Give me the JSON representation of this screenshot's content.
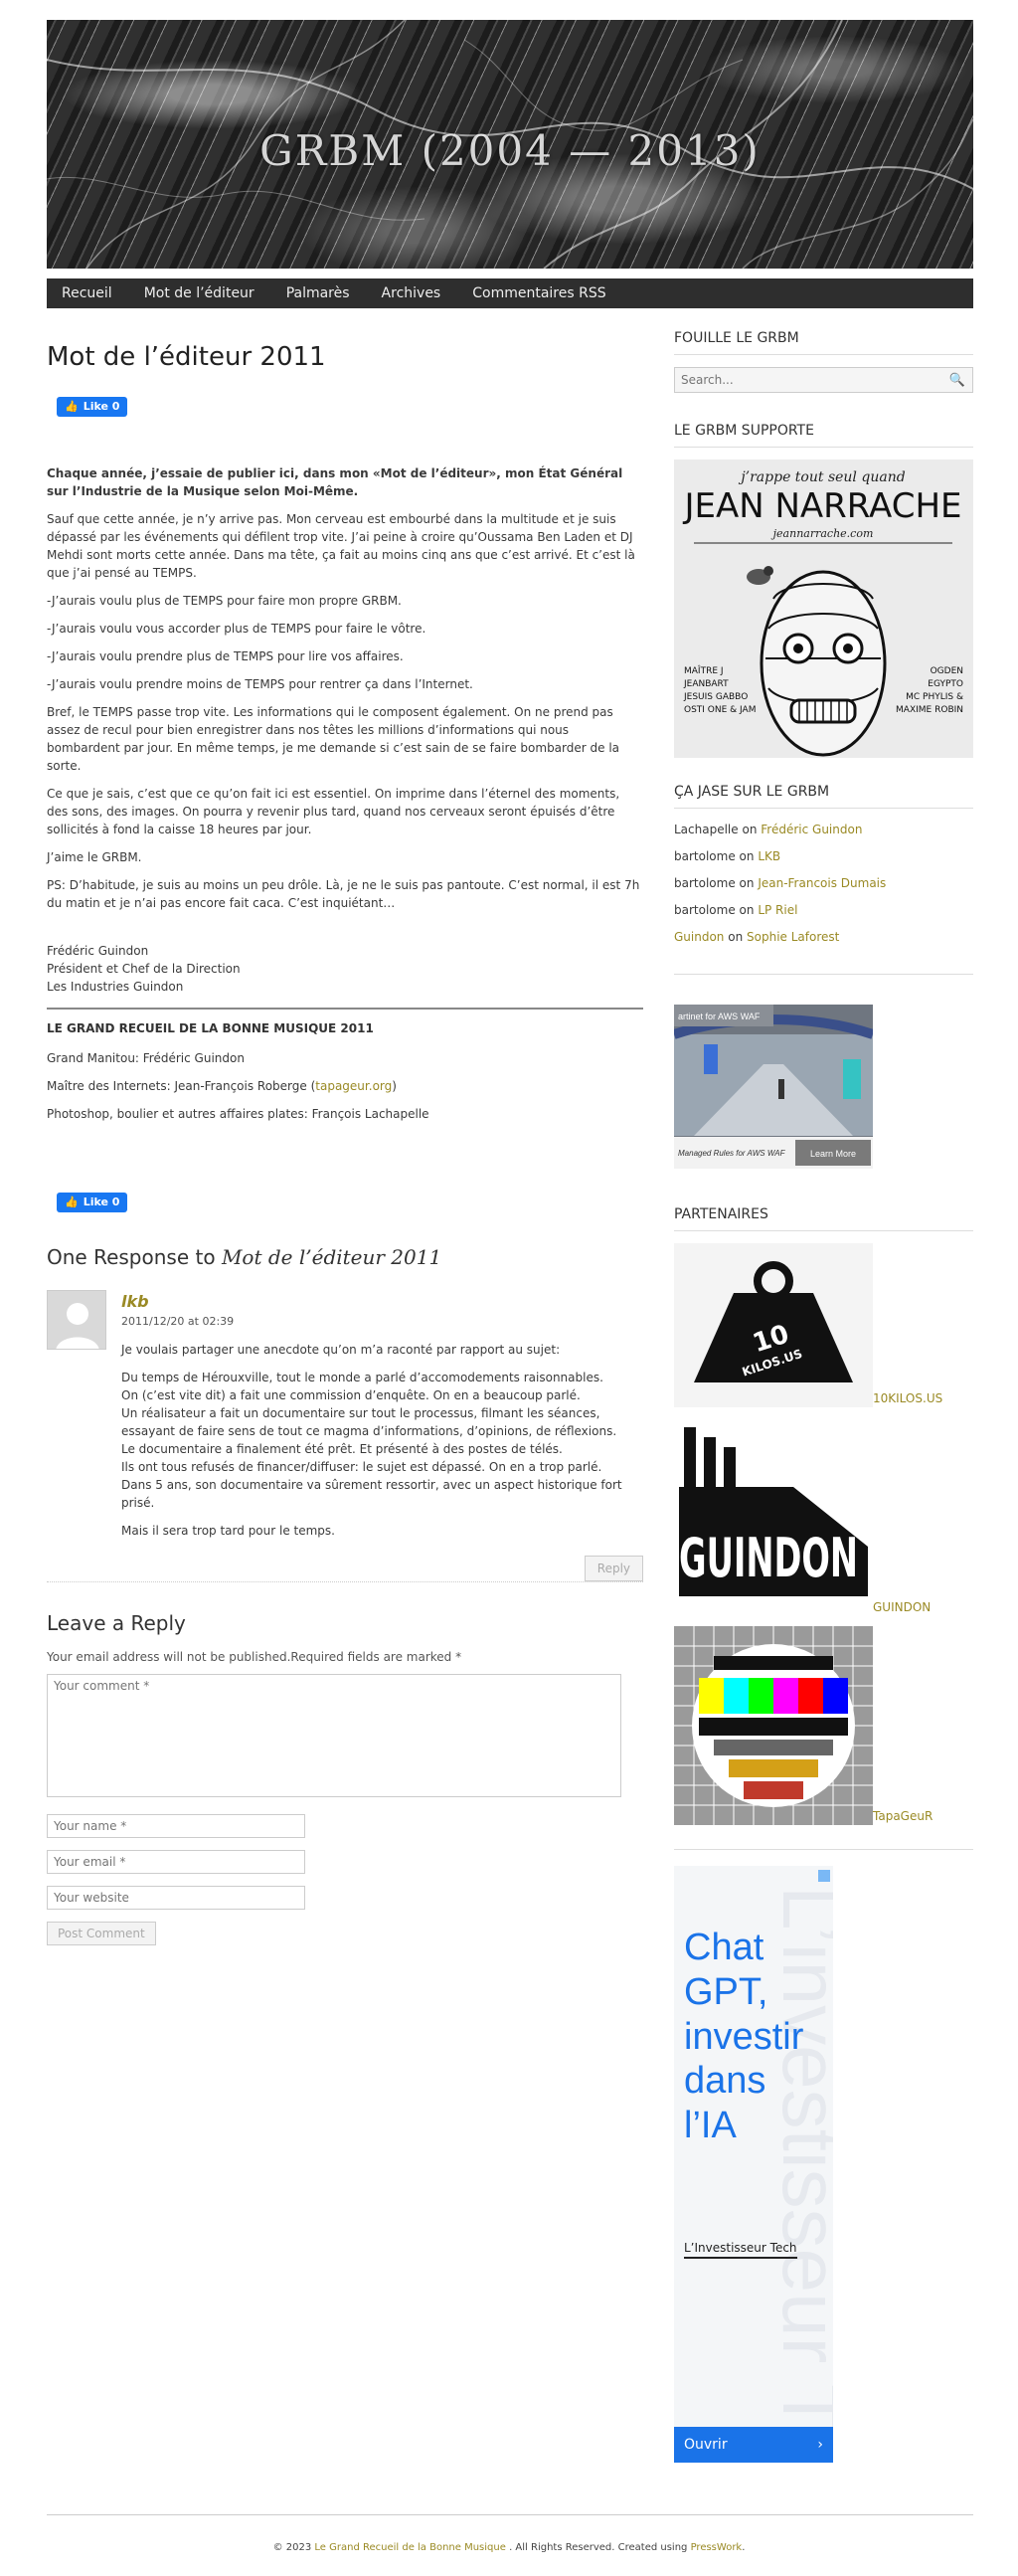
{
  "header": {
    "title": "GRBM (2004 — 2013)"
  },
  "nav": [
    "Recueil",
    "Mot de l’éditeur",
    "Palmarès",
    "Archives",
    "Commentaires RSS"
  ],
  "post": {
    "title": "Mot de l’éditeur 2011",
    "like_label": "Like 0",
    "lead": "Chaque année, j’essaie de publier ici, dans mon «Mot de l’éditeur», mon État Général sur l’Industrie de la Musique selon Moi-Même.",
    "paragraphs": [
      "Sauf que cette année, je n’y arrive pas. Mon cerveau est embourbé dans la multitude et je suis dépassé par les événements qui défilent trop vite.  J’ai peine à croire qu’Oussama Ben Laden et DJ Mehdi sont morts cette année. Dans ma tête, ça fait au moins cinq ans que c’est arrivé.  Et c’est là que j’ai pensé au TEMPS.",
      "-J’aurais voulu plus de TEMPS pour faire mon propre GRBM.",
      "-J’aurais voulu vous accorder plus de TEMPS pour faire le vôtre.",
      "-J’aurais voulu prendre plus de TEMPS pour lire vos affaires.",
      "-J’aurais voulu prendre moins de TEMPS pour rentrer ça dans l’Internet.",
      "Bref, le TEMPS passe trop vite. Les informations qui le composent également. On ne prend pas assez de recul pour bien enregistrer dans nos têtes les millions d’informations qui nous bombardent par jour. En même temps, je me demande si c’est sain de se faire bombarder de la sorte.",
      "Ce que je sais, c’est que ce qu’on fait ici est essentiel.  On imprime dans l’éternel des moments, des sons, des images. On pourra y revenir plus tard, quand nos cerveaux seront épuisés d’être sollicités à fond la caisse 18 heures par jour.",
      "J’aime le GRBM.",
      "PS: D’habitude, je suis au moins un peu drôle. Là, je ne le suis pas pantoute. C’est normal, il est 7h du matin et je n’ai pas encore fait caca. C’est inquiétant…"
    ],
    "signature": [
      "Frédéric Guindon",
      "Président et Chef de la Direction",
      "Les Industries Guindon"
    ],
    "credits_heading": "LE GRAND RECUEIL DE LA BONNE MUSIQUE 2011",
    "credit_manitou": "Grand Manitou: Frédéric Guindon",
    "credit_internet_pre": "Maître des Internets: Jean-François Roberge (",
    "credit_internet_link": "tapageur.org",
    "credit_internet_post": ")",
    "credit_photoshop": "Photoshop, boulier et autres affaires plates: François Lachapelle"
  },
  "comments": {
    "title_pre": "One Response to ",
    "title_em": "Mot de l’éditeur 2011",
    "items": [
      {
        "author": "lkb",
        "date": "2011/12/20 at 02:39",
        "intro": "Je voulais partager une anecdote qu’on m’a raconté par rapport au sujet:",
        "lines": [
          "Du temps de Hérouxville, tout le monde a parlé d’accomodements raisonnables.",
          "On (c’est vite dit) a fait une commission d’enquête. On en a beaucoup parlé.",
          "Un réalisateur a fait un documentaire sur tout le processus, filmant les séances, essayant de faire sens de tout ce magma d’informations, d’opinions, de réflexions.",
          "Le documentaire a finalement été prêt. Et présenté à des postes de télés.",
          "Ils ont tous refusés de financer/diffuser: le sujet est dépassé. On en a trop parlé.",
          "Dans 5 ans, son documentaire va sûrement ressortir, avec un aspect historique fort prisé."
        ],
        "outro": "Mais il sera trop tard pour le temps.",
        "reply_label": "Reply"
      }
    ]
  },
  "reply_form": {
    "title": "Leave a Reply",
    "note": "Your email address will not be published.Required fields are marked *",
    "comment_placeholder": "Your comment *",
    "name_placeholder": "Your name *",
    "email_placeholder": "Your email *",
    "website_placeholder": "Your website",
    "submit_label": "Post Comment"
  },
  "sidebar": {
    "search_title": "FOUILLE LE GRBM",
    "search_placeholder": "Search...",
    "support_title": "LE GRBM SUPPORTE",
    "narrache": {
      "tagline": "j’rappe tout seul quand",
      "name": "JEAN NARRACHE",
      "site": "jeannarrache.com",
      "left_names": [
        "MAÎTRE J",
        "JEANBART",
        "JESUIS GABBO",
        "OSTI ONE & JAM"
      ],
      "right_names": [
        "OGDEN",
        "EGYPTO",
        "MC PHYLIS &",
        "MAXIME ROBIN"
      ]
    },
    "jase_title": "ÇA JASE SUR LE GRBM",
    "jase": [
      {
        "who": "Lachapelle",
        "on": "on",
        "post": "Frédéric Guindon",
        "who_link": false
      },
      {
        "who": "bartolome",
        "on": "on",
        "post": "LKB",
        "who_link": false
      },
      {
        "who": "bartolome",
        "on": "on",
        "post": "Jean-Francois Dumais",
        "who_link": false
      },
      {
        "who": "bartolome",
        "on": "on",
        "post": "LP Riel",
        "who_link": false
      },
      {
        "who": "Guindon",
        "on": "on",
        "post": "Sophie Laforest",
        "who_link": true
      }
    ],
    "ad_small": {
      "top_text": "artinet for AWS WAF",
      "bottom_text": "Managed Rules for AWS WAF",
      "button": "Learn More"
    },
    "partners_title": "PARTENAIRES",
    "partners": [
      {
        "label": "10KILOS.US",
        "image_text": "10 KILOS.US"
      },
      {
        "label": "GUINDON",
        "image_text": "GUINDON"
      },
      {
        "label": "TapaGeuR",
        "image_text": ""
      }
    ],
    "ad_tall": {
      "headline": [
        "Chat",
        "GPT,",
        "investir",
        "dans",
        "l’IA"
      ],
      "brand": "L’Investisseur Tech",
      "button": "Ouvrir",
      "bg_text": "L’investisseur Tech"
    }
  },
  "footer": {
    "pre": "© 2023 ",
    "site": "Le Grand Recueil de la Bonne Musique",
    "mid": " . All Rights Reserved. Created using ",
    "credit": "PressWork",
    "post": "."
  },
  "colors": {
    "link": "#9a8a25",
    "nav_bg": "#2e2e2e",
    "fb_blue": "#1877f2",
    "ad_blue": "#1a73e8"
  }
}
